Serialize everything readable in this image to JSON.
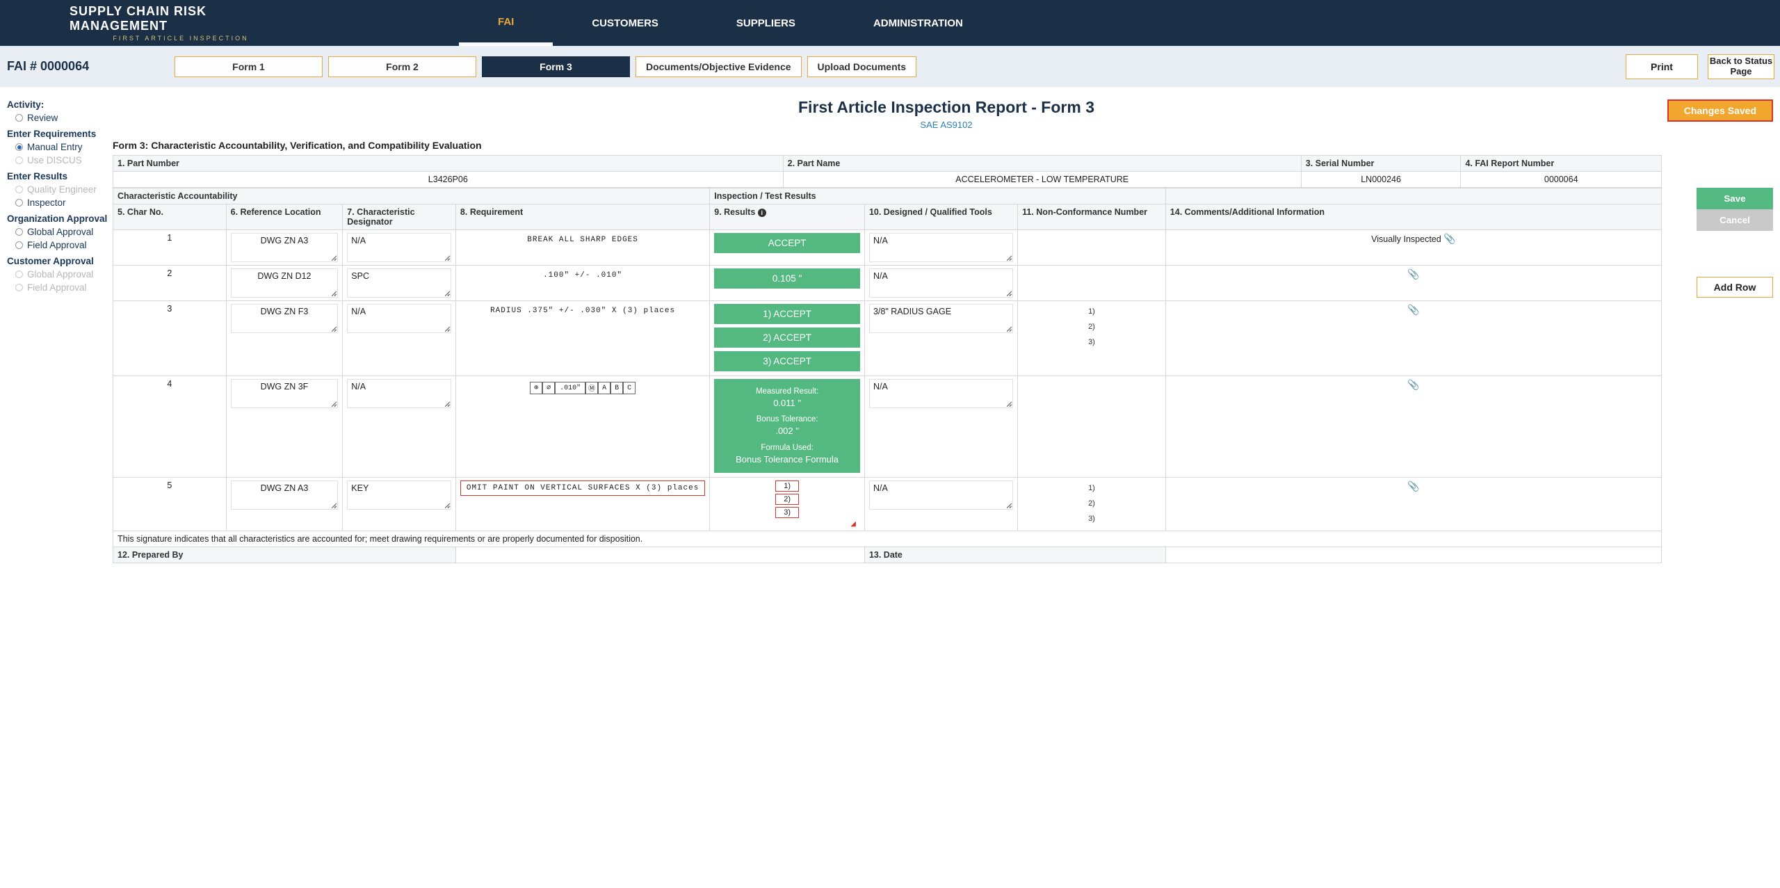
{
  "brand": {
    "title": "SUPPLY CHAIN RISK MANAGEMENT",
    "sub": "FIRST ARTICLE INSPECTION"
  },
  "topnav": {
    "fai": "FAI",
    "customers": "CUSTOMERS",
    "suppliers": "SUPPLIERS",
    "admin": "ADMINISTRATION"
  },
  "fai_id": "FAI # 0000064",
  "formtabs": {
    "f1": "Form 1",
    "f2": "Form 2",
    "f3": "Form 3",
    "docs": "Documents/Objective Evidence",
    "upload": "Upload Documents"
  },
  "actions": {
    "print": "Print",
    "status": "Back to Status Page",
    "changes": "Changes Saved",
    "save": "Save",
    "cancel": "Cancel",
    "addrow": "Add Row"
  },
  "title": "First Article Inspection Report - Form 3",
  "subtitle": "SAE AS9102",
  "form_label": "Form 3: Characteristic Accountability, Verification, and Compatibility Evaluation",
  "sidebar": {
    "activity": "Activity:",
    "review": "Review",
    "enter_req": "Enter Requirements",
    "manual": "Manual Entry",
    "discus": "Use DISCUS",
    "enter_res": "Enter Results",
    "qe": "Quality Engineer",
    "insp": "Inspector",
    "org": "Organization Approval",
    "ga": "Global Approval",
    "fa": "Field Approval",
    "cust": "Customer Approval",
    "cga": "Global Approval",
    "cfa": "Field Approval"
  },
  "hdr": {
    "pn": "1. Part Number",
    "pname": "2. Part Name",
    "sn": "3. Serial Number",
    "rpt": "4. FAI Report Number",
    "pn_v": "L3426P06",
    "pname_v": "ACCELEROMETER - LOW TEMPERATURE",
    "sn_v": "LN000246",
    "rpt_v": "0000064",
    "sect_a": "Characteristic Accountability",
    "sect_b": "Inspection / Test Results",
    "c5": "5. Char No.",
    "c6": "6. Reference Location",
    "c7": "7. Characteristic Designator",
    "c8": "8. Requirement",
    "c9": "9. Results",
    "c10": "10. Designed / Qualified Tools",
    "c11": "11. Non-Conformance Number",
    "c14": "14. Comments/Additional Information"
  },
  "rows": {
    "1": {
      "no": "1",
      "ref": "DWG ZN A3",
      "desig": "N/A",
      "req": "BREAK ALL SHARP EDGES",
      "res": "ACCEPT",
      "tools": "N/A",
      "comment": "Visually Inspected"
    },
    "2": {
      "no": "2",
      "ref": "DWG ZN D12",
      "desig": "SPC",
      "req": ".100\" +/- .010\"",
      "res": "0.105 \"",
      "tools": "N/A"
    },
    "3": {
      "no": "3",
      "ref": "DWG ZN F3",
      "desig": "N/A",
      "req": "RADIUS .375\" +/- .030\" X (3) places",
      "r1": "1) ACCEPT",
      "r2": "2) ACCEPT",
      "r3": "3) ACCEPT",
      "tools": "3/8\" RADIUS GAGE",
      "n1": "1)",
      "n2": "2)",
      "n3": "3)"
    },
    "4": {
      "no": "4",
      "ref": "DWG ZN 3F",
      "desig": "N/A",
      "gdt_tol": ".010\"",
      "gdt_a": "A",
      "gdt_b": "B",
      "gdt_c": "C",
      "mr_l": "Measured Result:",
      "mr_v": "0.011 \"",
      "bt_l": "Bonus Tolerance:",
      "bt_v": ".002 \"",
      "fu_l": "Formula Used:",
      "fu_v": "Bonus Tolerance Formula",
      "tools": "N/A"
    },
    "5": {
      "no": "5",
      "ref": "DWG ZN A3",
      "desig": "KEY",
      "req": "OMIT PAINT ON VERTICAL SURFACES X (3) places",
      "b1": "1)",
      "b2": "2)",
      "b3": "3)",
      "tools": "N/A",
      "n1": "1)",
      "n2": "2)",
      "n3": "3)"
    }
  },
  "footer": {
    "sig": "This signature indicates that all characteristics are accounted for; meet drawing requirements or are properly documented for disposition.",
    "prep": "12. Prepared By",
    "date": "13. Date"
  }
}
